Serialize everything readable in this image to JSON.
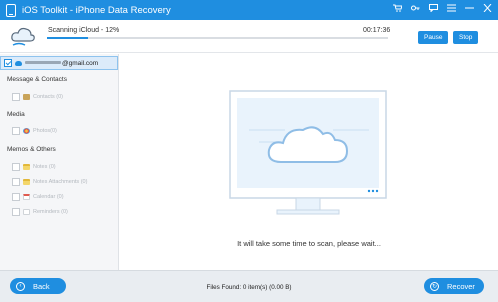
{
  "window": {
    "title": "iOS Toolkit - iPhone Data Recovery",
    "controls": [
      "cart-icon",
      "key-icon",
      "chat-icon",
      "menu-icon",
      "minimize-icon",
      "close-icon"
    ]
  },
  "scan": {
    "status": "Scanning iCloud - 12%",
    "elapsed": "00:17:36",
    "progress_percent": 12,
    "pause_label": "Pause",
    "stop_label": "Stop"
  },
  "sidebar": {
    "account": "@gmail.com",
    "sections": [
      {
        "title": "Message & Contacts",
        "items": [
          {
            "label": "Contacts (0)",
            "icon": "contacts-icon"
          }
        ]
      },
      {
        "title": "Media",
        "items": [
          {
            "label": "Photos(0)",
            "icon": "photos-icon"
          }
        ]
      },
      {
        "title": "Memos & Others",
        "items": [
          {
            "label": "Notes (0)",
            "icon": "notes-icon"
          },
          {
            "label": "Notes Attachments (0)",
            "icon": "notes-attachments-icon"
          },
          {
            "label": "Calendar (0)",
            "icon": "calendar-icon"
          },
          {
            "label": "Reminders (0)",
            "icon": "reminders-icon"
          }
        ]
      }
    ]
  },
  "main": {
    "wait_message": "It will take some time to scan, please wait..."
  },
  "footer": {
    "back_label": "Back",
    "files_found": "Files Found: 0 item(s) (0.00 B)",
    "recover_label": "Recover"
  },
  "colors": {
    "accent": "#1f8ee0",
    "titlebar": "#1f8ee0",
    "footer_bg": "#e9edf1",
    "sidebar_bg": "#f5f6f8"
  }
}
